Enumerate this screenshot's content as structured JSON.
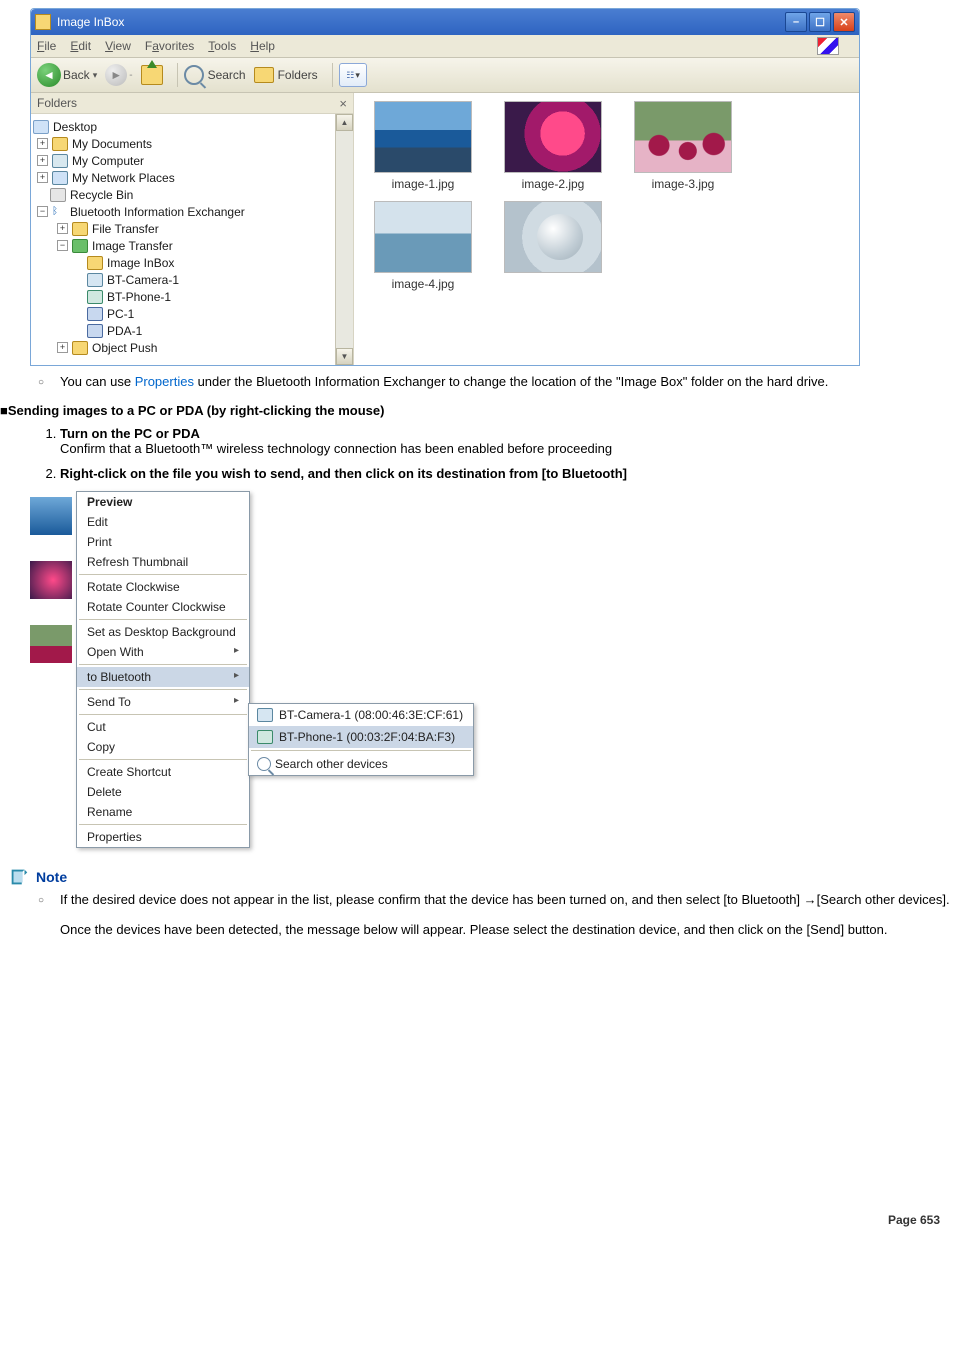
{
  "win1": {
    "title": "Image InBox",
    "menus": {
      "file": "File",
      "edit": "Edit",
      "view": "View",
      "fav": "Favorites",
      "tools": "Tools",
      "help": "Help"
    },
    "toolbar": {
      "back": "Back",
      "search": "Search",
      "folders": "Folders"
    },
    "panehdr": "Folders",
    "tree": {
      "desktop": "Desktop",
      "mydocs": "My Documents",
      "mycomp": "My Computer",
      "mynet": "My Network Places",
      "recycle": "Recycle Bin",
      "bie": "Bluetooth Information Exchanger",
      "filetr": "File Transfer",
      "imgtr": "Image Transfer",
      "inbox": "Image InBox",
      "btcam": "BT-Camera-1",
      "btphone": "BT-Phone-1",
      "pc1": "PC-1",
      "pda1": "PDA-1",
      "objpush": "Object Push"
    },
    "thumbs": {
      "i1": "image-1.jpg",
      "i2": "image-2.jpg",
      "i3": "image-3.jpg",
      "i4": "image-4.jpg"
    }
  },
  "text": {
    "bullet1a": "You can use ",
    "bullet1link": "Properties",
    "bullet1b": " under the Bluetooth Information Exchanger to change the location of the \"Image Box\" folder on the hard drive.",
    "sectHdr": "■Sending images to a PC or PDA (by right-clicking the mouse)",
    "step1t": "Turn on the PC or PDA",
    "step1b": "Confirm that a Bluetooth™ wireless technology connection has been enabled before proceeding",
    "step2t": "Right-click on the file you wish to send, and then click on its destination from [to Bluetooth]",
    "noteLabel": "Note",
    "noteBody1": "If the desired device does not appear in the list, please confirm that the device has been turned on, and then select [to Bluetooth] →[Search other devices].",
    "noteBody2": "Once the devices have been detected, the message below will appear. Please select the destination device, and then click on the [Send] button.",
    "pageNum": "Page  653"
  },
  "cmenu": {
    "preview": "Preview",
    "edit": "Edit",
    "print": "Print",
    "refresh": "Refresh Thumbnail",
    "rotcw": "Rotate Clockwise",
    "rotccw": "Rotate Counter Clockwise",
    "setbg": "Set as Desktop Background",
    "openwith": "Open With",
    "tobt": "to Bluetooth",
    "sendto": "Send To",
    "cut": "Cut",
    "copy": "Copy",
    "shortcut": "Create Shortcut",
    "delete": "Delete",
    "rename": "Rename",
    "props": "Properties"
  },
  "submenu": {
    "cam": "BT-Camera-1 (08:00:46:3E:CF:61)",
    "phone": "BT-Phone-1 (00:03:2F:04:BA:F3)",
    "search": "Search other devices"
  }
}
